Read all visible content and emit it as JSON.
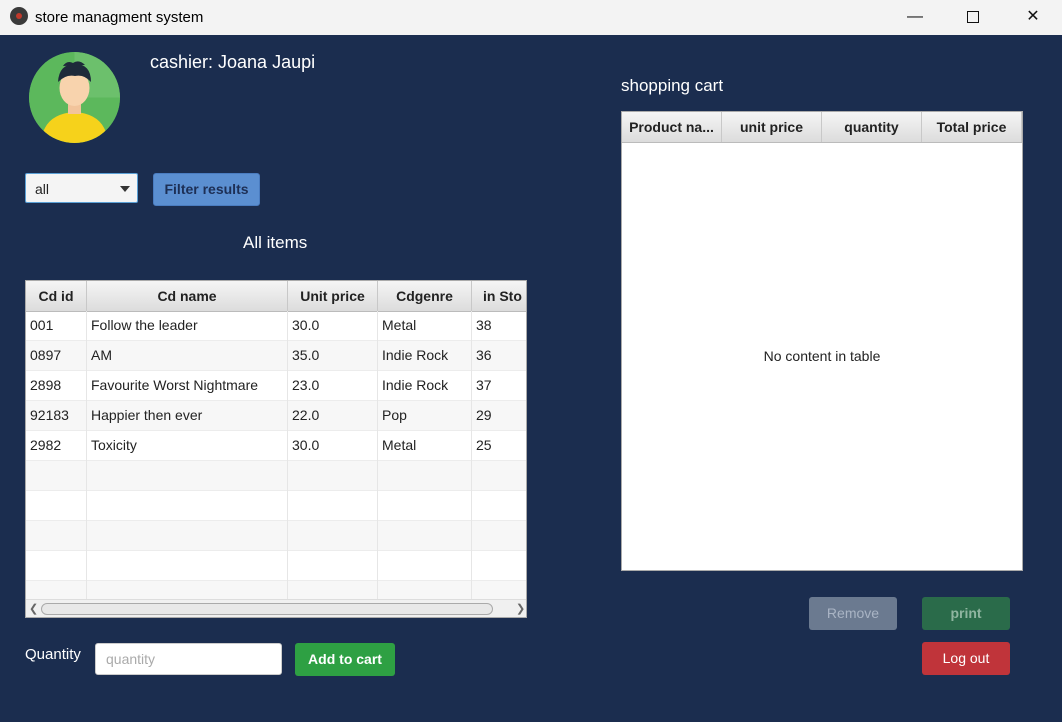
{
  "window": {
    "title": "store managment system",
    "minimize": "—",
    "close": "✕"
  },
  "header": {
    "cashier": "cashier: Joana Jaupi"
  },
  "filter": {
    "selected": "all",
    "button_label": "Filter results"
  },
  "items_title": "All items",
  "items_table": {
    "columns": [
      "Cd id",
      "Cd name",
      "Unit price",
      "Cdgenre",
      "in Sto"
    ],
    "rows": [
      [
        "001",
        "Follow the leader",
        "30.0",
        "Metal",
        "38"
      ],
      [
        "0897",
        "AM",
        "35.0",
        "Indie Rock",
        "36"
      ],
      [
        "2898",
        "Favourite Worst Nightmare",
        "23.0",
        "Indie Rock",
        "37"
      ],
      [
        "92183",
        "Happier then ever",
        "22.0",
        "Pop",
        "29"
      ],
      [
        "2982",
        "Toxicity",
        "30.0",
        "Metal",
        "25"
      ]
    ]
  },
  "quantity": {
    "label": "Quantity",
    "placeholder": "quantity",
    "value": ""
  },
  "add_button": "Add to cart",
  "cart": {
    "title": "shopping cart",
    "columns": [
      "Product na...",
      "unit price",
      "quantity",
      "Total price"
    ],
    "empty_text": "No content in table"
  },
  "actions": {
    "remove": "Remove",
    "print": "print",
    "logout": "Log out"
  },
  "colors": {
    "background": "#1b2d4f",
    "filter_button": "#5b8fd1",
    "add_button": "#2ea043",
    "logout_button": "#c0343a",
    "print_button": "#2a6b4a",
    "remove_button": "#6b7a90"
  }
}
